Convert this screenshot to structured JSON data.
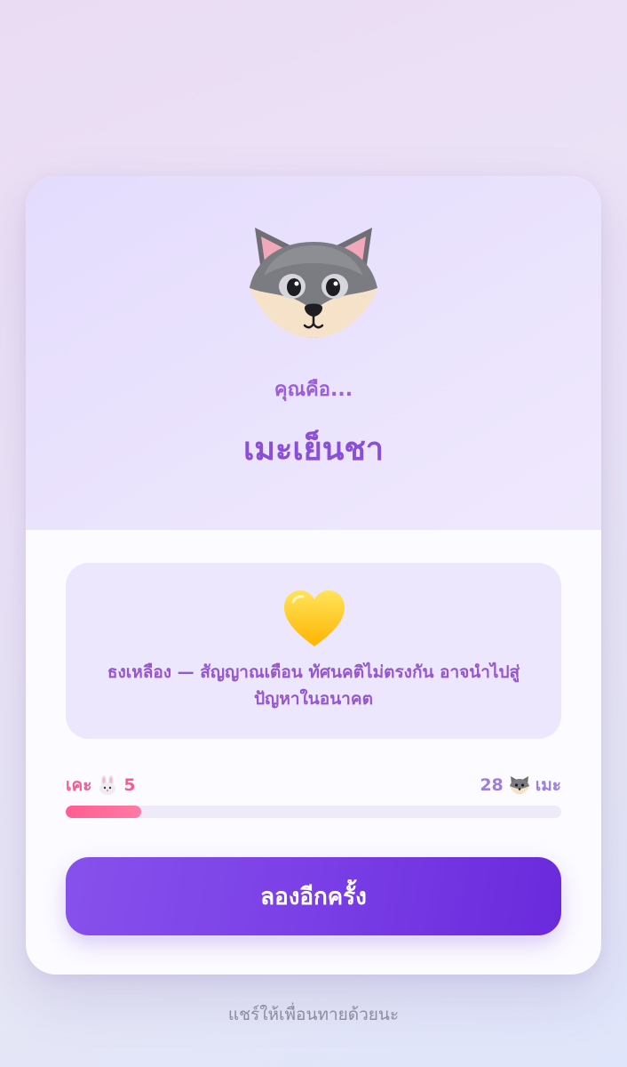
{
  "result": {
    "avatar_icon": "wolf-face-icon",
    "pre_title": "คุณคือ...",
    "title": "เมะเย็นชา"
  },
  "info": {
    "icon": "yellow-heart-icon",
    "text": "ธงเหลือง — สัญญาณเตือน ทัศนคติไม่ตรงกัน อาจนำไปสู่ปัญหาในอนาคต"
  },
  "score": {
    "left_label": "เคะ",
    "left_icon": "rabbit-face-icon",
    "left_value": "5",
    "right_value": "28",
    "right_icon": "wolf-face-icon",
    "right_label": "เมะ",
    "progress_fraction": 0.152
  },
  "actions": {
    "retry_label": "ลองอีกครั้ง"
  },
  "footer": {
    "share_text": "แชร์ให้เพื่อนทายด้วยนะ"
  },
  "colors": {
    "accent_purple": "#8a4fd6",
    "pink": "#ee5e97",
    "heart_yellow": "#ffc21a"
  }
}
